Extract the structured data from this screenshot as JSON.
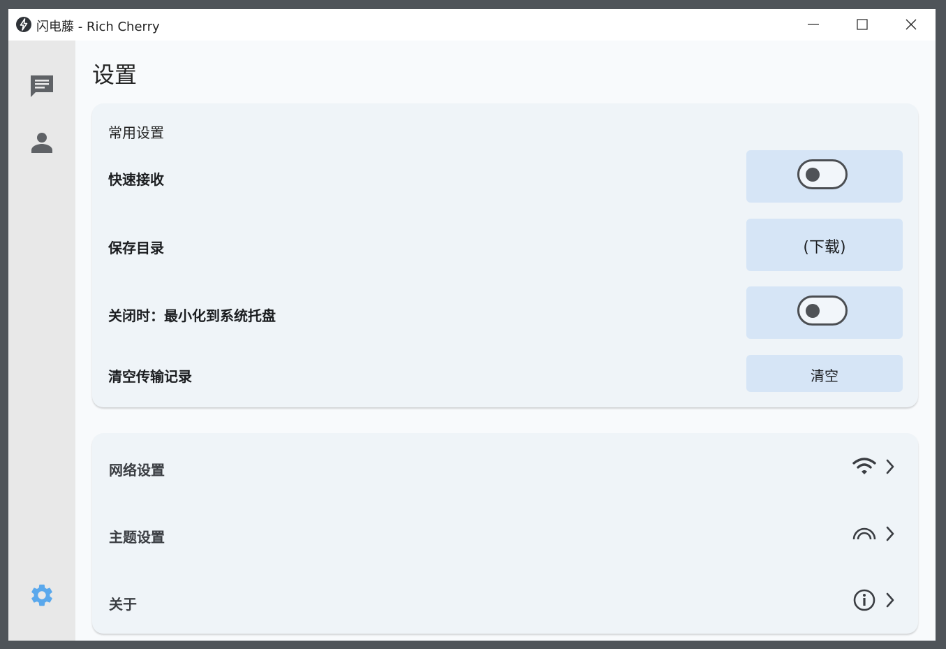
{
  "window": {
    "title": "闪电藤 - Rich Cherry",
    "controls": [
      "minimize-icon",
      "maximize-icon",
      "close-icon"
    ]
  },
  "sidebar": {
    "items": [
      {
        "id": "messages",
        "icon": "chat-icon",
        "active": false
      },
      {
        "id": "contacts",
        "icon": "person-icon",
        "active": false
      },
      {
        "id": "settings",
        "icon": "gear-icon",
        "active": true,
        "color": "#5aa8ec"
      }
    ]
  },
  "page": {
    "title": "设置"
  },
  "general": {
    "section_title": "常用设置",
    "quick_receive": {
      "label": "快速接收",
      "enabled": false
    },
    "save_dir": {
      "label": "保存目录",
      "value": "(下载)"
    },
    "minimize_tray": {
      "label": "关闭时：最小化到系统托盘",
      "enabled": false
    },
    "clear_history": {
      "label": "清空传输记录",
      "button": "清空"
    }
  },
  "nav": {
    "network": {
      "label": "网络设置",
      "icon": "wifi-icon"
    },
    "theme": {
      "label": "主题设置",
      "icon": "rainbow-icon"
    },
    "about": {
      "label": "关于",
      "icon": "info-icon"
    }
  },
  "colors": {
    "accent": "#5aa8ec",
    "control_bg": "#d6e5f6",
    "card_bg": "#eff4f8",
    "sidebar_bg": "#e8e8e8"
  }
}
